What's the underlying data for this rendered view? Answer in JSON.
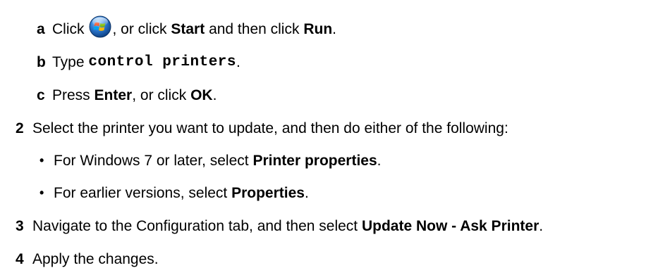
{
  "step1_substeps": {
    "a": {
      "marker": "a",
      "text1": "Click",
      "text2": ", or click",
      "bold1": "Start",
      "text3": "and then click",
      "bold2": "Run",
      "text4": "."
    },
    "b": {
      "marker": "b",
      "text1": "Type",
      "code": "control printers",
      "text2": "."
    },
    "c": {
      "marker": "c",
      "text1": "Press",
      "bold1": "Enter",
      "text2": ", or click",
      "bold2": "OK",
      "text3": "."
    }
  },
  "step2": {
    "number": "2",
    "text": "Select the printer you want to update, and then do either of the following:",
    "bullets": [
      {
        "symbol": "•",
        "text": "For Windows 7 or later, select",
        "bold": "Printer properties",
        "end": "."
      },
      {
        "symbol": "•",
        "text": "For earlier versions, select",
        "bold": "Properties",
        "end": "."
      }
    ]
  },
  "step3": {
    "number": "3",
    "text": "Navigate to the Configuration tab, and then select",
    "bold": "Update Now - Ask Printer",
    "end": "."
  },
  "step4": {
    "number": "4",
    "text": "Apply the changes."
  },
  "icons": {
    "start_button": "windows-start-orb-icon"
  },
  "colors": {
    "text": "#000000",
    "background": "#ffffff",
    "orb_blue": "#1a5fb4"
  }
}
